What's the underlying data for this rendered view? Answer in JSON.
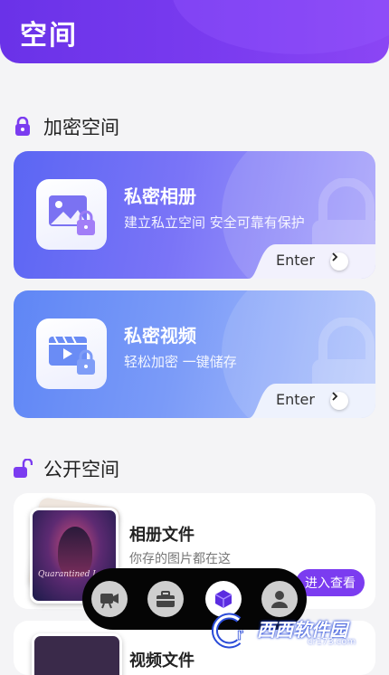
{
  "header": {
    "title": "空间"
  },
  "encrypted_section": {
    "title": "加密空间"
  },
  "cards": [
    {
      "title": "私密相册",
      "subtitle": "建立私立空间 安全可靠有保护",
      "enter": "Enter"
    },
    {
      "title": "私密视频",
      "subtitle": "轻松加密 一键储存",
      "enter": "Enter"
    }
  ],
  "public_section": {
    "title": "公开空间"
  },
  "list_items": [
    {
      "title": "相册文件",
      "subtitle": "你存的图片都在这",
      "button": "进入查看",
      "thumb_caption": "Quarantined Love"
    },
    {
      "title": "视频文件"
    }
  ],
  "tabbar": {
    "items": [
      "video-camera",
      "toolbox",
      "cube",
      "profile"
    ],
    "active": 2
  },
  "watermark": {
    "text": "西西软件园",
    "url": "cr173.com"
  },
  "colors": {
    "accent": "#7b3cf0",
    "card1": "#5b66f3",
    "card2": "#5f86f5",
    "tabbar": "#050505"
  }
}
